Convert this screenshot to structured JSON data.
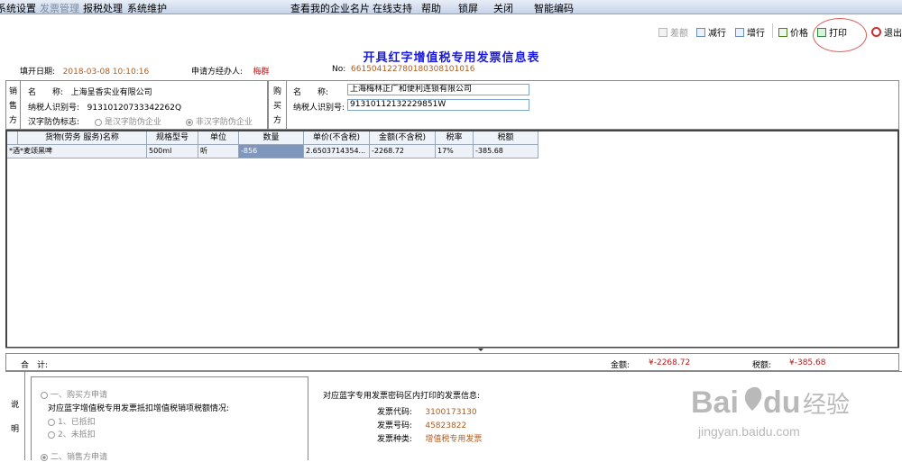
{
  "menubar": {
    "items": [
      "系统设置",
      "发票管理",
      "报税处理",
      "系统维护"
    ],
    "right_items": [
      "查看我的企业名片",
      "在线支持",
      "帮助",
      "锁屏",
      "关闭",
      "智能编码"
    ]
  },
  "toolbar": {
    "buttons": [
      {
        "label": "差额",
        "icon": "doc-icon",
        "enabled": false
      },
      {
        "label": "减行",
        "icon": "remove-row-icon",
        "enabled": true
      },
      {
        "label": "增行",
        "icon": "add-row-icon",
        "enabled": true
      },
      {
        "label": "价格",
        "icon": "price-icon",
        "enabled": true
      },
      {
        "label": "打印",
        "icon": "print-icon",
        "enabled": true
      },
      {
        "label": "退出",
        "icon": "power-icon",
        "enabled": true
      }
    ]
  },
  "form": {
    "title": "开具红字增值税专用发票信息表",
    "date_label": "填开日期:",
    "date_value": "2018-03-08 10:10:16",
    "applicant_label": "申请方经办人:",
    "applicant_value": "梅群",
    "no_label": "No:",
    "no_value": "661504122780180308101016"
  },
  "seller": {
    "side_label": [
      "销",
      "售",
      "方"
    ],
    "name_label": "名　　称:",
    "name_value": "上海呈香实业有限公司",
    "tax_label": "纳税人识别号:",
    "tax_value": "91310120733342262Q",
    "anti_label": "汉字防伪标志:",
    "anti_option_1": "是汉字防伪企业",
    "anti_option_2": "非汉字防伪企业"
  },
  "buyer": {
    "side_label": [
      "购",
      "买",
      "方"
    ],
    "name_label": "名　　称:",
    "name_value": "上海梅林正广和便利连锁有限公司",
    "tax_label": "纳税人识别号:",
    "tax_value": "91310112132229851W"
  },
  "goods_table": {
    "columns": [
      "货物(劳务 服务)名称",
      "规格型号",
      "单位",
      "数量",
      "单价(不含税)",
      "金额(不含税)",
      "税率",
      "税额"
    ],
    "rows": [
      [
        "*酒*麦颂黑啤",
        "500ml",
        "听",
        "-856",
        "2.6503714354...",
        "-2268.72",
        "17%",
        "-385.68"
      ]
    ]
  },
  "totals": {
    "label": "合　计:",
    "amount_label": "金额:",
    "amount_value": "¥-2268.72",
    "tax_label": "税额:",
    "tax_value": "¥-385.68"
  },
  "notes": {
    "side_label": [
      "说",
      "明"
    ],
    "opt_buyer": "一、购买方申请",
    "question": "对应蓝字增值税专用发票抵扣增值税销项税额情况:",
    "opt_deducted": "1、已抵扣",
    "opt_not_deducted": "2、未抵扣",
    "opt_seller": "二、销售方申请",
    "blue_info_title": "对应蓝字专用发票密码区内打印的发票信息:",
    "code_label": "发票代码:",
    "code_value": "3100173130",
    "number_label": "发票号码:",
    "number_value": "45823822",
    "kind_label": "发票种类:",
    "kind_value": "增值税专用发票"
  },
  "watermark": {
    "brand": "Bai",
    "brand2": "du",
    "cn": "经验",
    "url": "jingyan.baidu.com"
  }
}
